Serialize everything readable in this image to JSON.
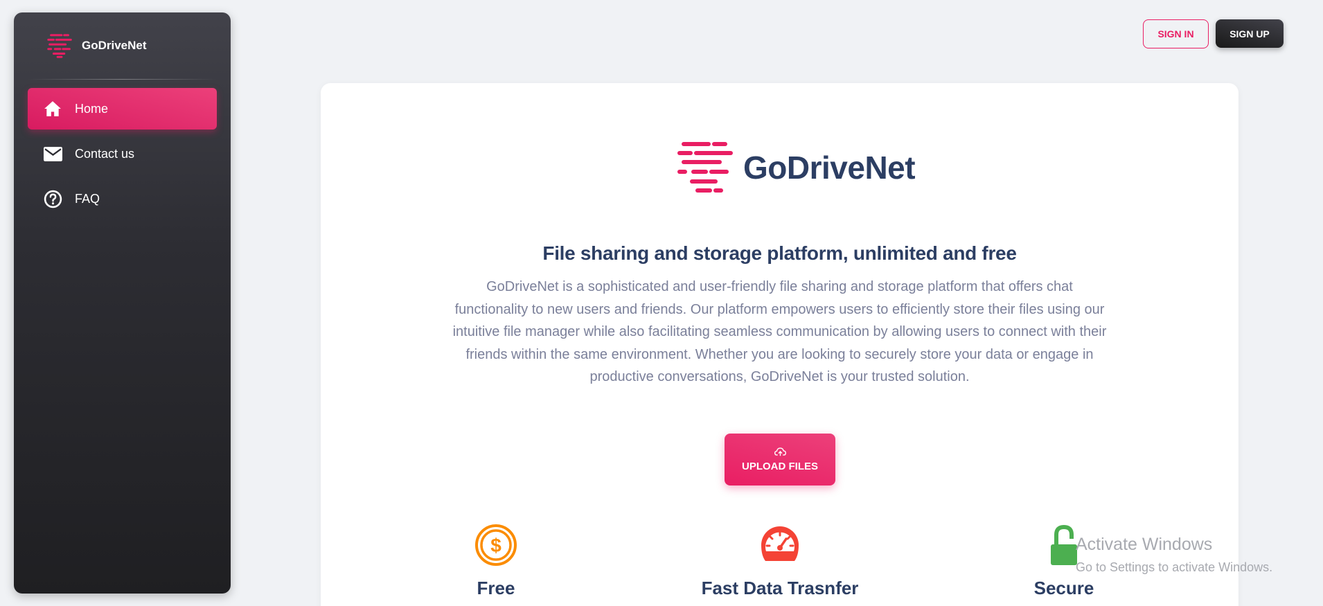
{
  "brand": {
    "name": "GoDriveNet",
    "accent_color": "#e91e63",
    "logo_icon": "godrivenet-logo-icon"
  },
  "sidebar": {
    "items": [
      {
        "label": "Home",
        "icon": "home-icon",
        "active": true
      },
      {
        "label": "Contact us",
        "icon": "mail-icon",
        "active": false
      },
      {
        "label": "FAQ",
        "icon": "help-circle-icon",
        "active": false
      }
    ]
  },
  "header": {
    "sign_in_label": "SIGN IN",
    "sign_up_label": "SIGN UP"
  },
  "hero": {
    "name": "GoDriveNet",
    "headline": "File sharing and storage platform, unlimited and free",
    "description": "GoDriveNet is a sophisticated and user-friendly file sharing and storage platform that offers chat functionality to new users and friends. Our platform empowers users to efficiently store their files using our intuitive file manager while also facilitating seamless communication by allowing users to connect with their friends within the same environment. Whether you are looking to securely store your data or engage in productive conversations, GoDriveNet is your trusted solution.",
    "upload_label": "UPLOAD FILES",
    "upload_icon": "cloud-upload-icon"
  },
  "features": [
    {
      "title": "Free",
      "icon": "dollar-coin-icon",
      "color": "#fb8c00"
    },
    {
      "title": "Fast Data Trasnfer",
      "icon": "speedometer-icon",
      "color": "#f44335"
    },
    {
      "title": "Secure",
      "icon": "lock-icon",
      "color": "#4caf50"
    }
  ],
  "watermark": {
    "title": "Activate Windows",
    "subtitle": "Go to Settings to activate Windows."
  }
}
